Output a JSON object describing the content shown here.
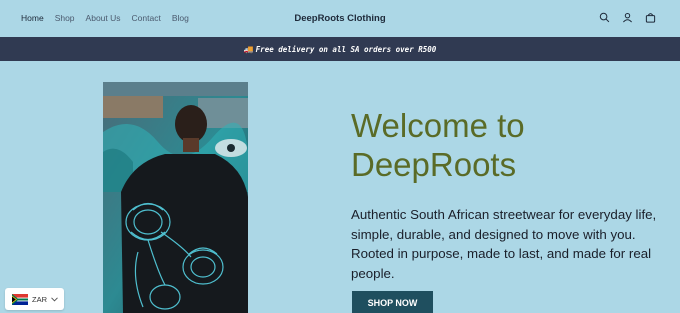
{
  "nav": {
    "items": [
      {
        "label": "Home"
      },
      {
        "label": "Shop"
      },
      {
        "label": "About Us"
      },
      {
        "label": "Contact"
      },
      {
        "label": "Blog"
      }
    ]
  },
  "brand": "DeepRoots Clothing",
  "header_icons": [
    "search-icon",
    "account-icon",
    "cart-icon"
  ],
  "announcement": {
    "emoji": "🚚",
    "text": "Free delivery on all SA orders over R500"
  },
  "hero": {
    "title_line1": "Welcome to",
    "title_line2": "DeepRoots",
    "description": "Authentic South African streetwear for everyday life, simple, durable, and designed to move with you. Rooted in purpose, made to last, and made for real people.",
    "cta": "SHOP NOW"
  },
  "currency": {
    "code": "ZAR",
    "flag": "south-africa-flag-icon"
  },
  "colors": {
    "background": "#acd7e6",
    "announcement_bg": "#303a52",
    "title": "#5a6b27",
    "button_bg": "#1f4f5f"
  }
}
